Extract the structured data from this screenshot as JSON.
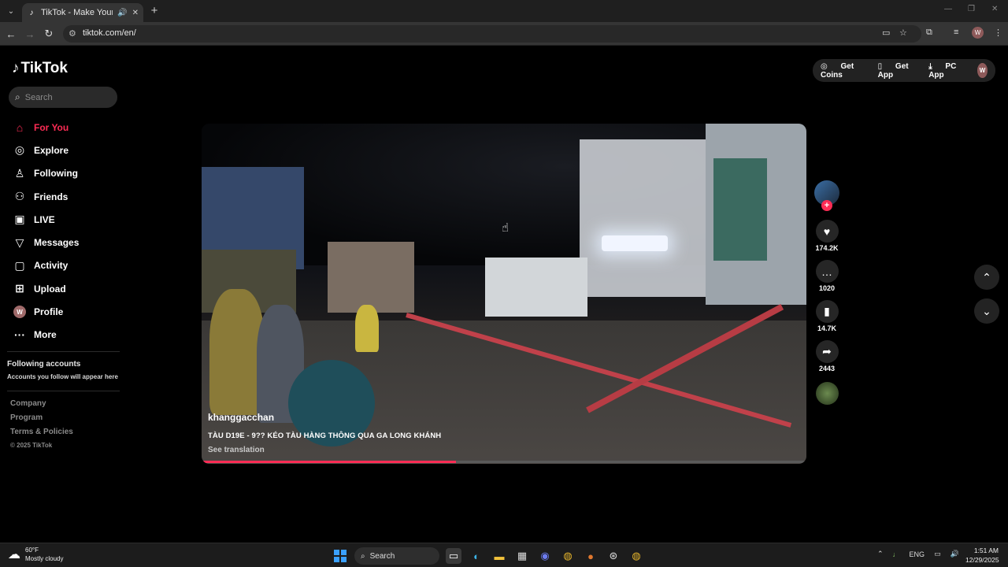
{
  "browser": {
    "tab_title": "TikTok - Make Your Day",
    "url": "tiktok.com/en/",
    "profile_initial": "W"
  },
  "sidebar": {
    "logo": "TikTok",
    "search_placeholder": "Search",
    "nav": [
      {
        "label": "For You",
        "icon": "home-icon",
        "active": true
      },
      {
        "label": "Explore",
        "icon": "compass-icon"
      },
      {
        "label": "Following",
        "icon": "following-icon"
      },
      {
        "label": "Friends",
        "icon": "friends-icon"
      },
      {
        "label": "LIVE",
        "icon": "live-icon"
      },
      {
        "label": "Messages",
        "icon": "messages-icon"
      },
      {
        "label": "Activity",
        "icon": "activity-icon"
      },
      {
        "label": "Upload",
        "icon": "upload-icon"
      },
      {
        "label": "Profile",
        "icon": "profile-avatar"
      },
      {
        "label": "More",
        "icon": "more-icon"
      }
    ],
    "following_title": "Following accounts",
    "following_sub": "Accounts you follow will appear here",
    "footer": [
      "Company",
      "Program",
      "Terms & Policies"
    ],
    "copyright": "© 2025 TikTok"
  },
  "topbar": {
    "get_coins": "Get Coins",
    "get_app": "Get App",
    "pc_app": "PC App",
    "avatar_initial": "W"
  },
  "video": {
    "username": "khanggacchan",
    "caption": "TÀU D19E - 9?? KÉO TÀU HÀNG THÔNG QUA GA LONG KHÁNH",
    "see_translation": "See translation",
    "progress": 0.42
  },
  "actions": {
    "likes": "174.2K",
    "comments": "1020",
    "saves": "14.7K",
    "shares": "2443"
  },
  "taskbar": {
    "temp": "60°F",
    "weather": "Mostly cloudy",
    "search": "Search",
    "lang": "ENG",
    "time": "1:51 AM",
    "date": "12/29/2025"
  }
}
